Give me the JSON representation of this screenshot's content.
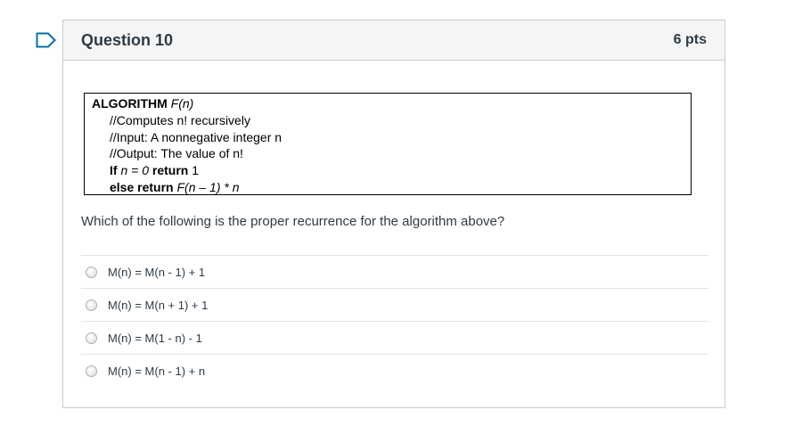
{
  "question": {
    "title": "Question 10",
    "points": "6 pts",
    "algorithm": {
      "line1_keyword": "ALGORITHM",
      "line1_name": "F(n)",
      "line2": "//Computes n! recursively",
      "line3": "//Input:  A nonnegative integer n",
      "line4": "//Output:  The value of n!",
      "line5_if": "If",
      "line5_cond": "n = 0",
      "line5_return": "return",
      "line5_value": "1",
      "line6_else": "else return",
      "line6_call": "F(n",
      "line6_rest": "– 1) * n"
    },
    "prompt": "Which of the following is the proper recurrence for the algorithm above?",
    "answers": [
      {
        "label": "M(n) = M(n - 1) + 1"
      },
      {
        "label": "M(n) = M(n + 1) + 1"
      },
      {
        "label": "M(n) = M(1 - n) - 1"
      },
      {
        "label": "M(n) = M(n - 1) + n"
      }
    ]
  },
  "colors": {
    "accent_flag": "#0770a3",
    "header_bg": "#f5f5f5",
    "border": "#c7cdd1",
    "text": "#2d3b45"
  },
  "icons": {
    "flag": "flag-icon",
    "radio": "radio-unselected-icon"
  }
}
